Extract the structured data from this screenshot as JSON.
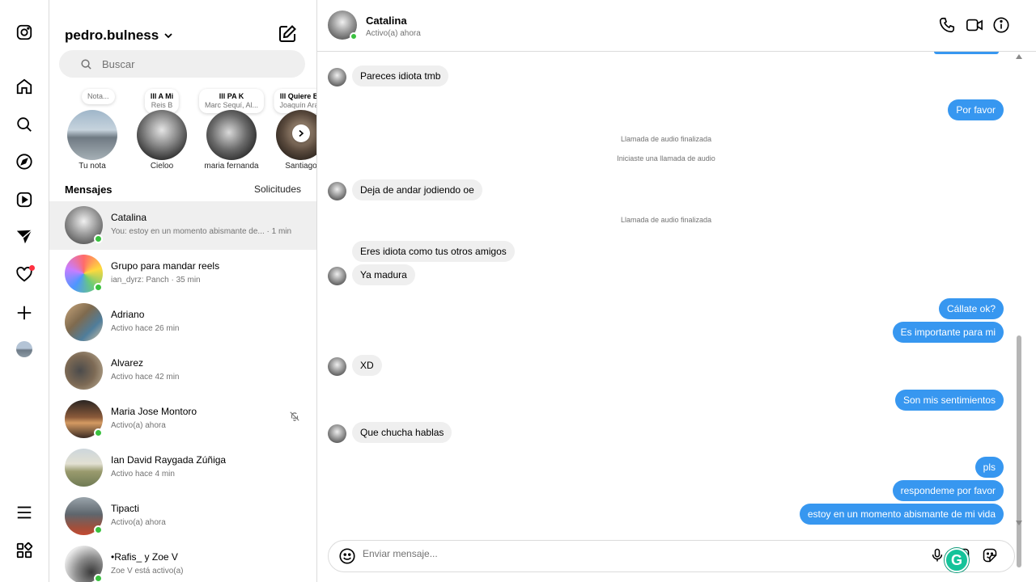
{
  "rail": {
    "icons": [
      "instagram-icon",
      "home-icon",
      "search-icon",
      "explore-icon",
      "reels-icon",
      "messages-icon",
      "notifications-icon",
      "create-icon",
      "profile-avatar",
      "menu-icon",
      "more-apps-icon"
    ]
  },
  "list": {
    "account": "pedro.bulness",
    "search_placeholder": "Buscar",
    "notes": [
      {
        "bubble_title": "",
        "bubble_sub": "Nota...",
        "name": "Tu nota"
      },
      {
        "bubble_title": "lll A Mi",
        "bubble_sub": "Reis B",
        "name": "Cieloo"
      },
      {
        "bubble_title": "lll PA K",
        "bubble_sub": "Marc Sequí, Al...",
        "name": "maria fernanda"
      },
      {
        "bubble_title": "lll Quiere Ba",
        "bubble_sub": "Joaquín Aran",
        "name": "Santiago"
      }
    ],
    "section_title": "Mensajes",
    "requests_label": "Solicitudes",
    "threads": [
      {
        "name": "Catalina",
        "sub": "You: estoy en un momento abismante de... · 1 min"
      },
      {
        "name": "Grupo para mandar reels",
        "sub": "ian_dyrz: Panch · 35 min"
      },
      {
        "name": "Adriano",
        "sub": "Activo hace 26 min"
      },
      {
        "name": "Alvarez",
        "sub": "Activo hace 42 min"
      },
      {
        "name": "Maria Jose Montoro",
        "sub": "Activo(a) ahora"
      },
      {
        "name": "Ian David Raygada Zúñiga",
        "sub": "Activo hace 4 min"
      },
      {
        "name": "Tipacti",
        "sub": "Activo(a) ahora"
      },
      {
        "name": "•Rafis_ y Zoe V",
        "sub": "Zoe V está activo(a)"
      }
    ]
  },
  "chat": {
    "contact_name": "Catalina",
    "contact_status": "Activo(a) ahora",
    "messages": {
      "m1": "Pareces idiota tmb",
      "m2": "Por favor",
      "s1": "Llamada de audio finalizada",
      "s2": "Iniciaste una llamada de audio",
      "m3": "Deja de andar jodiendo oe",
      "s3": "Llamada de audio finalizada",
      "m4": "Eres idiota como tus otros amigos",
      "m5": "Ya madura",
      "m6": "Cállate ok?",
      "m7": "Es importante para mi",
      "m8": "XD",
      "m9": "Son mis sentimientos",
      "m10": "Que chucha hablas",
      "m11": "pls",
      "m12": "respondeme por favor",
      "m13": "estoy en un momento abismante de mi vida"
    },
    "composer_placeholder": "Enviar mensaje...",
    "grammarly_letter": "G"
  },
  "colors": {
    "outgoing_bubble": "#3797f0",
    "incoming_bubble": "#efefef",
    "online_dot": "#3ac13f",
    "notification_dot": "#ff3040"
  }
}
